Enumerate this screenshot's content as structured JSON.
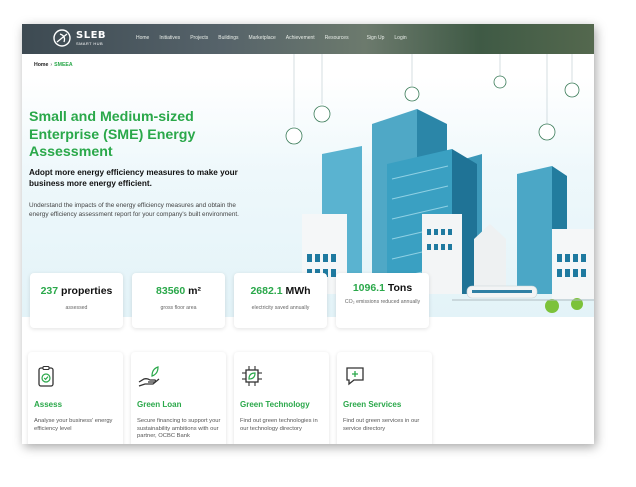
{
  "nav": {
    "logo_title": "SLEB",
    "logo_subtitle": "SMART HUB",
    "links": [
      "Home",
      "Initiatives",
      "Projects",
      "Buildings",
      "Marketplace",
      "Achievement",
      "Resources",
      "Sign Up",
      "Login"
    ]
  },
  "breadcrumb": {
    "home": "Home",
    "separator": "›",
    "current": "SMEEA"
  },
  "hero": {
    "title": "Small and Medium-sized Enterprise (SME) Energy Assessment",
    "subtitle": "Adopt more energy efficiency measures to make your business more energy efficient.",
    "description": "Understand the impacts of the energy efficiency measures and obtain the energy efficiency assessment report for your company's built environment."
  },
  "stats": [
    {
      "value": "237",
      "unit": "properties",
      "label": "assessed"
    },
    {
      "value": "83560",
      "unit": "m²",
      "label": "gross floor area"
    },
    {
      "value": "2682.1",
      "unit": "MWh",
      "label": "electricity saved annually"
    },
    {
      "value": "1096.1",
      "unit": "Tons",
      "label": "CO₂ emissions reduced annually"
    }
  ],
  "cards": [
    {
      "title": "Assess",
      "desc": "Analyse your business' energy efficiency level",
      "icon": "clipboard-check-icon"
    },
    {
      "title": "Green Loan",
      "desc": "Secure financing to support your sustainability ambitions with our partner, OCBC Bank",
      "icon": "hand-sprout-icon"
    },
    {
      "title": "Green Technology",
      "desc": "Find out green technologies in our technology directory",
      "icon": "chip-leaf-icon"
    },
    {
      "title": "Green Services",
      "desc": "Find out green services in our service directory",
      "icon": "chat-plus-icon"
    }
  ],
  "colors": {
    "accent": "#2aa84a",
    "nav_bg": "#4b5a5f",
    "building": "#2e8fb0"
  }
}
